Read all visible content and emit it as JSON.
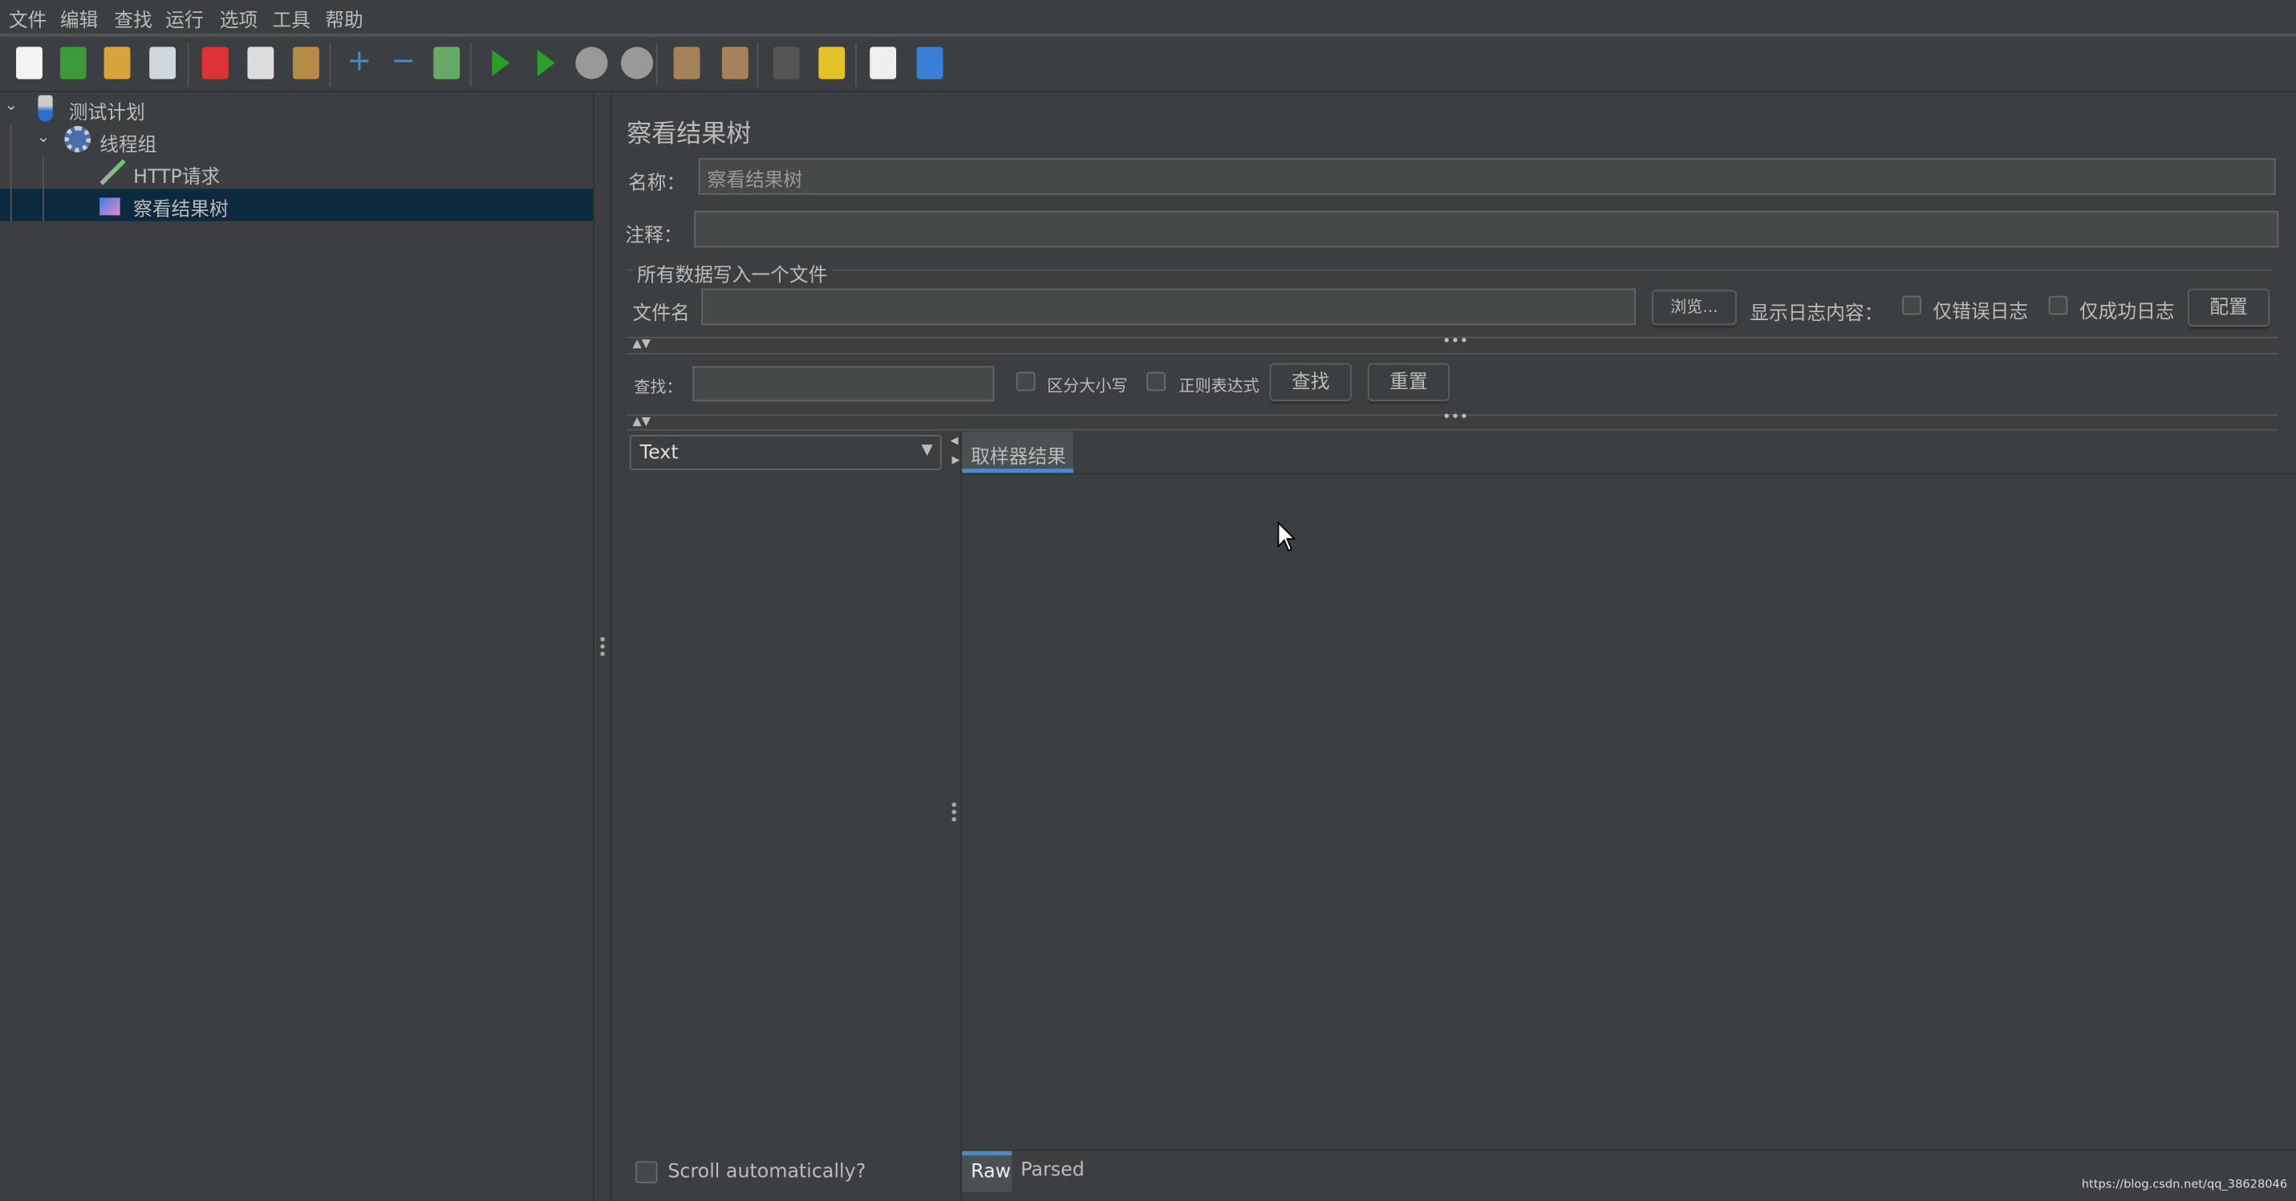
{
  "menu": [
    "文件",
    "编辑",
    "查找",
    "运行",
    "选项",
    "工具",
    "帮助"
  ],
  "toolbar": [
    "new-icon",
    "templates-icon",
    "open-icon",
    "save-icon",
    "cut-icon",
    "copy-icon",
    "paste-icon",
    "expand-icon",
    "collapse-icon",
    "toggle-icon",
    "start-icon",
    "start-no-pause-icon",
    "stop-icon",
    "shutdown-icon",
    "clear-icon",
    "clear-all-icon",
    "search-icon",
    "reset-search-icon",
    "function-helper-icon",
    "help-icon"
  ],
  "tree": {
    "items": [
      {
        "label": "测试计划",
        "icon": "test-plan-icon"
      },
      {
        "label": "线程组",
        "icon": "thread-group-icon"
      },
      {
        "label": "HTTP请求",
        "icon": "http-sampler-icon"
      },
      {
        "label": "察看结果树",
        "icon": "listener-icon",
        "selected": true
      }
    ]
  },
  "panel": {
    "title": "察看结果树",
    "name_label": "名称：",
    "name_value": "察看结果树",
    "comment_label": "注释：",
    "comment_value": "",
    "file_section": "所有数据写入一个文件",
    "file_label": "文件名",
    "file_value": "",
    "browse": "浏览...",
    "log_label": "显示日志内容：",
    "errors_only": "仅错误日志",
    "success_only": "仅成功日志",
    "configure": "配置",
    "search_label": "查找：",
    "search_value": "",
    "case_sensitive": "区分大小写",
    "regex": "正则表达式",
    "search_btn": "查找",
    "reset_btn": "重置",
    "renderer": "Text",
    "tab_sampler": "取样器结果",
    "scroll_auto": "Scroll automatically?",
    "tab_raw": "Raw",
    "tab_parsed": "Parsed"
  },
  "watermark": "https://blog.csdn.net/qq_38628046",
  "colors": {
    "accent": "#4a88c7",
    "selected": "#0d293e",
    "bg": "#3c3f41"
  }
}
